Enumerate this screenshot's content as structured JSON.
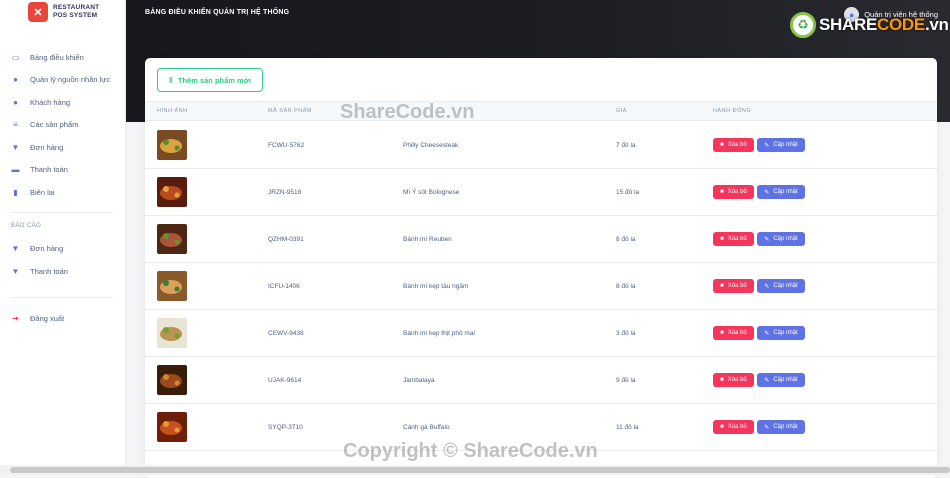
{
  "brand": {
    "line1": "RESTAURANT",
    "line2": "POS SYSTEM"
  },
  "sidebar": {
    "items": [
      {
        "icon": "monitor-icon",
        "label": "Bảng điều khiển"
      },
      {
        "icon": "user-icon",
        "label": "Quản lý nguồn nhân lực"
      },
      {
        "icon": "users-icon",
        "label": "Khách hàng"
      },
      {
        "icon": "list-icon",
        "label": "Các sản phẩm"
      },
      {
        "icon": "cart-icon",
        "label": "Đơn hàng"
      },
      {
        "icon": "credit-card-icon",
        "label": "Thanh toán"
      },
      {
        "icon": "receipt-icon",
        "label": "Biên lai"
      }
    ],
    "report_heading": "BÁO CÁO",
    "report_items": [
      {
        "icon": "basket-icon",
        "label": "Đơn hàng"
      },
      {
        "icon": "cart-arrow-icon",
        "label": "Thanh toán"
      }
    ],
    "logout": {
      "icon": "logout-icon",
      "label": "Đăng xuất"
    }
  },
  "header": {
    "title": "BẢNG ĐIỀU KHIỂN QUẢN TRỊ HỆ THỐNG",
    "admin": "Quản trị viên hệ thống"
  },
  "toolbar": {
    "add_label": "Thêm sản phẩm mới"
  },
  "table": {
    "headers": [
      "HÌNH ẢNH",
      "MÃ SẢN PHẨM",
      "",
      "GIÁ",
      "HÀNH ĐỘNG"
    ],
    "delete_label": "Xóa bỏ",
    "update_label": "Cập nhật",
    "rows": [
      {
        "code": "FCWU-5762",
        "name": "Philly Cheesesteak",
        "price": "7 đô la"
      },
      {
        "code": "JRZN-9518",
        "name": "Mì Ý sốt Bolognese",
        "price": "15 đô la"
      },
      {
        "code": "QZHM-0391",
        "name": "Bánh mì Reuben",
        "price": "8 đô la"
      },
      {
        "code": "ICFU-1406",
        "name": "Bánh mì kẹp tàu ngầm",
        "price": "8 đô la"
      },
      {
        "code": "CEWV-9438",
        "name": "Bánh mì kẹp thịt phô mai",
        "price": "3 đô la"
      },
      {
        "code": "UJAK-9614",
        "name": "Jambalaya",
        "price": "9 đô la"
      },
      {
        "code": "SYQP-3710",
        "name": "Cánh gà Buffalo",
        "price": "11 đô la"
      }
    ]
  },
  "watermark": {
    "center": "ShareCode.vn",
    "logo_a": "SHARE",
    "logo_b": "CODE",
    "logo_c": ".vn",
    "copyright": "Copyright © ShareCode.vn"
  },
  "colors": {
    "primary": "#5e72e4",
    "danger": "#f5365c",
    "success": "#2dce89"
  }
}
